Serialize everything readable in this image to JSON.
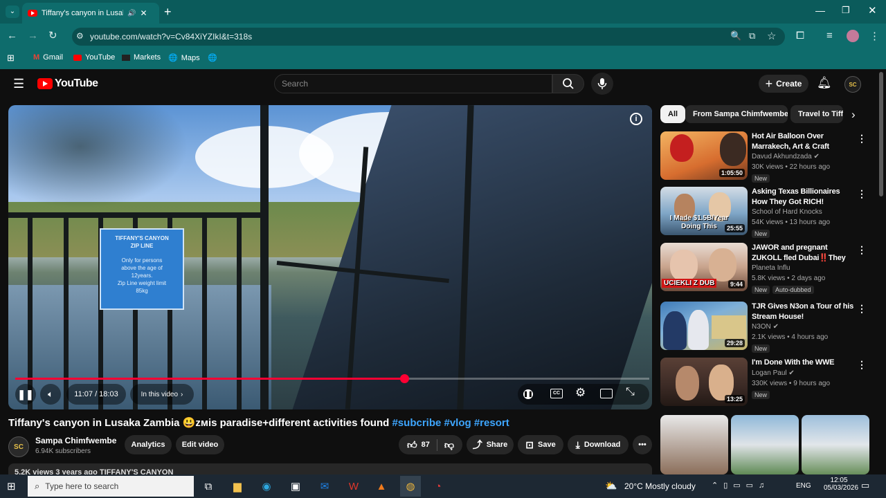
{
  "browser": {
    "tab_title": "Tiffany's canyon in Lusaka Zambia",
    "url": "youtube.com/watch?v=Cv84XiYZIkI&t=318s",
    "bookmarks": [
      "Gmail",
      "YouTube",
      "Markets",
      "Maps"
    ]
  },
  "youtube": {
    "logo": "YouTube",
    "search_placeholder": "Search",
    "create_label": "Create",
    "avatar_text": "SC"
  },
  "player": {
    "time": "11:07 / 18:03",
    "in_this_video": "In this video",
    "progress": 0.614
  },
  "video": {
    "title_main": "Tiffany's canyon in Lusaka Zambia 😃ᴢᴍis paradise+different activities found ",
    "tags": "#subcribe #vlog #resort",
    "channel": "Sampa Chimfwembe",
    "subscribers": "6.94K subscribers",
    "analytics": "Analytics",
    "edit_video": "Edit video",
    "likes": "87",
    "share": "Share",
    "save": "Save",
    "download": "Download",
    "desc_preview": "5.2K views  3 years ago  TIFFANY'S CANYON",
    "sign_text": "TIFFANY'S CANYON ZIP LINE — Only for persons above the age of 12years. Zip Line weight limit 85kg"
  },
  "chips": [
    "All",
    "From Sampa Chimfwembe",
    "Travel to Tiffany"
  ],
  "recommendations": [
    {
      "title": "Hot Air Balloon Over Marrakech, Art & Craft Shopping In Old ...",
      "channel": "Davud Akhundzada",
      "meta": "30K views • 22 hours ago",
      "badge": "New",
      "duration": "1:05:50",
      "colors": [
        "#d76d2f",
        "#f3b462"
      ]
    },
    {
      "title": "Asking Texas Billionaires How They Got RICH!",
      "channel": "School of Hard Knocks",
      "meta": "54K views • 13 hours ago",
      "badge": "New",
      "duration": "25:55",
      "overlay": "I Made $1.5B/Year Doing This",
      "colors": [
        "#7fa6c7",
        "#d4dde6"
      ]
    },
    {
      "title": "JAWOR and pregnant ZUKOLL fled Dubai‼️They paid the ...",
      "channel": "Planeta Influ",
      "meta": "5.8K views • 2 days ago",
      "badge": "New",
      "badge2": "Auto-dubbed",
      "duration": "9:44",
      "overlay": "UCIEKLI Z DUB",
      "colors": [
        "#c9a48d",
        "#6b4a3a"
      ]
    },
    {
      "title": "TJR Gives N3on a Tour of his Stream House!",
      "channel": "N3ON",
      "meta": "2.1K views • 4 hours ago",
      "badge": "New",
      "duration": "29:28",
      "colors": [
        "#3f7bb8",
        "#c8b66a"
      ]
    },
    {
      "title": "I'm Done With the WWE",
      "channel": "Logan Paul",
      "meta": "330K views • 9 hours ago",
      "badge": "New",
      "duration": "13:25",
      "colors": [
        "#3b2a25",
        "#a07a5d"
      ]
    }
  ],
  "taskbar": {
    "search_placeholder": "Type here to search",
    "weather": "20°C  Mostly cloudy",
    "lang": "ENG",
    "time": "12:05",
    "date": "05/03/2026"
  }
}
